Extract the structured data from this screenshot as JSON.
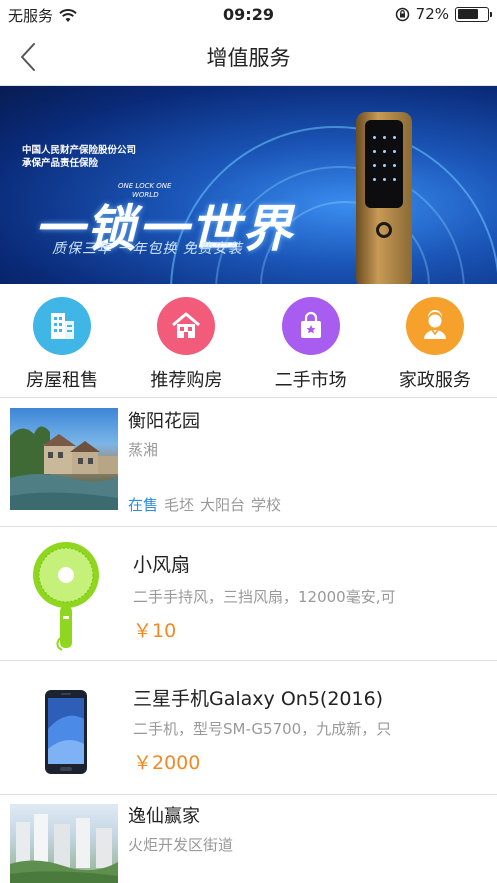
{
  "status_bar": {
    "carrier": "无服务",
    "time": "09:29",
    "battery_percent": "72%",
    "battery_level": 0.72
  },
  "nav": {
    "title": "增值服务"
  },
  "banner": {
    "company_line1": "中国人民财产保险股份公司",
    "company_line2": "承保产品责任保险",
    "small_line1": "ONE LOCK ONE",
    "small_line2": "WORLD",
    "title": "一锁一世界",
    "slogan": "质保三年  一年包换  免费安装"
  },
  "categories": [
    {
      "label": "房屋租售",
      "icon": "building-icon",
      "color": "#3fb6e6"
    },
    {
      "label": "推荐购房",
      "icon": "house-icon",
      "color": "#f25c7a"
    },
    {
      "label": "二手市场",
      "icon": "shopping-bag-icon",
      "color": "#a85cf0"
    },
    {
      "label": "家政服务",
      "icon": "housekeeper-icon",
      "color": "#f5a12b"
    }
  ],
  "listings": [
    {
      "title": "衡阳花园",
      "subtitle": "蒸湘",
      "status": "在售",
      "tags": [
        "毛坯",
        "大阳台",
        "学校"
      ]
    },
    {
      "title": "小风扇",
      "subtitle": "二手手持风，三挡风扇，12000毫安,可",
      "price": "￥10"
    },
    {
      "title": "三星手机Galaxy On5(2016)",
      "subtitle": "二手机，型号SM-G5700，九成新，只",
      "price": "￥2000"
    },
    {
      "title": "逸仙赢家",
      "subtitle": "火炬开发区街道"
    }
  ]
}
